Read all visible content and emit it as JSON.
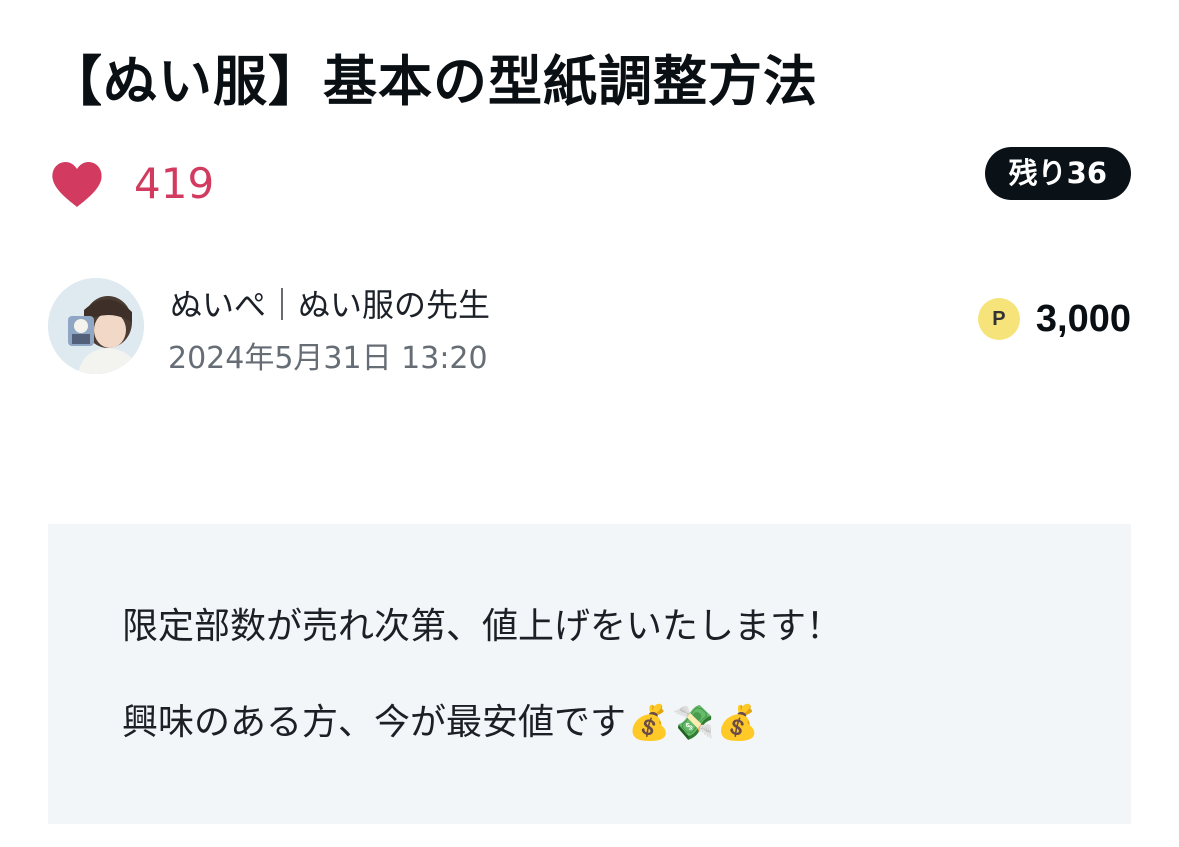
{
  "article": {
    "title": "【ぬい服】基本の型紙調整方法",
    "likes": "419",
    "remaining": "残り36",
    "author": "ぬいぺ｜ぬい服の先生",
    "date": "2024年5月31日 13:20",
    "price": "3,000",
    "point_icon": "P"
  },
  "notice": {
    "line1": "限定部数が売れ次第、値上げをいたします！",
    "line2": "興味のある方、今が最安値です",
    "emojis": [
      "💰",
      "💸",
      "💰"
    ]
  },
  "icons": {
    "heart": "heart-icon",
    "point": "point-icon",
    "avatar": "avatar"
  },
  "colors": {
    "like": "#d23a5f",
    "badge_bg": "#0b1217",
    "point_bg": "#f6e47a",
    "notice_bg": "#f3f6f9"
  }
}
